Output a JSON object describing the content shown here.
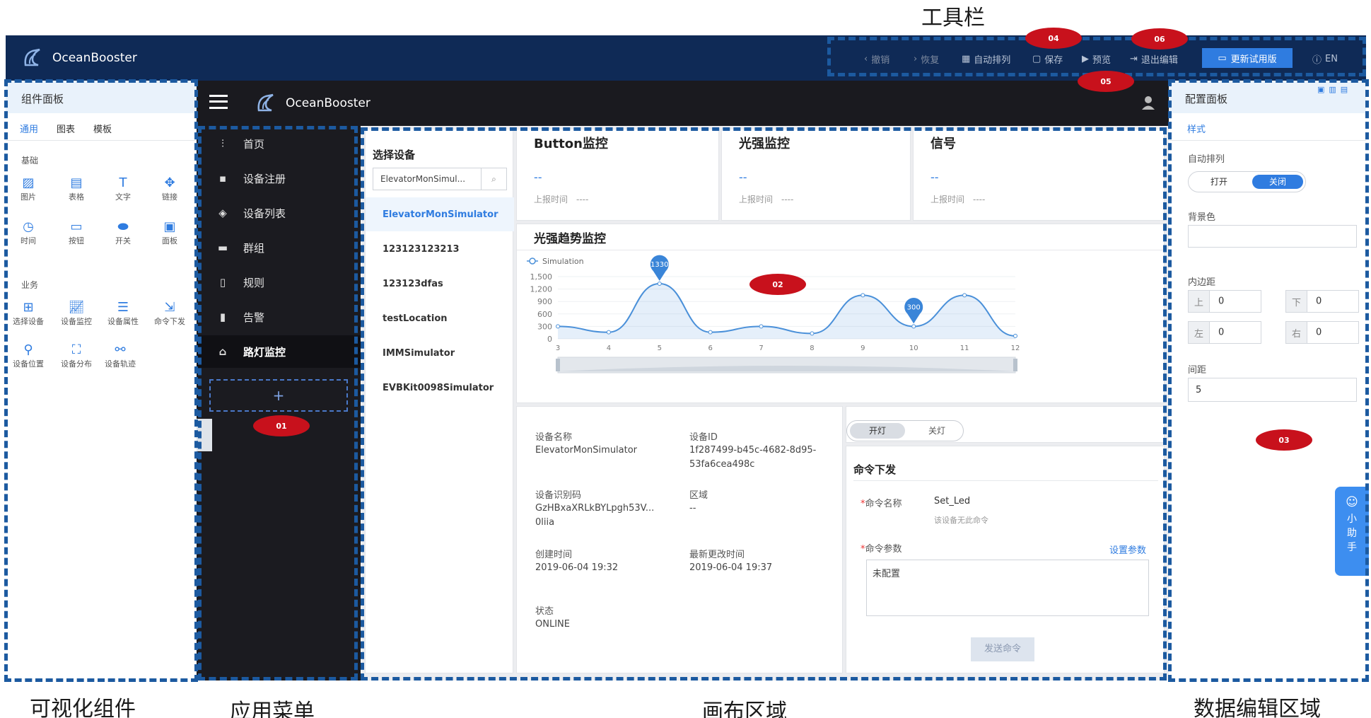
{
  "captions": {
    "toolbar": "工具栏",
    "components": "可视化组件",
    "app_menu": "应用菜单",
    "canvas": "画布区域",
    "data_edit": "数据编辑区域"
  },
  "badges": [
    "01",
    "02",
    "03",
    "04",
    "05",
    "06"
  ],
  "topbar": {
    "brand": "OceanBooster",
    "undo": "撤销",
    "redo": "恢复",
    "auto_arrange": "自动排列",
    "save": "保存",
    "preview": "预览",
    "exit_edit": "退出编辑",
    "trial": "更新试用版",
    "lang": "EN"
  },
  "component_panel": {
    "title": "组件面板",
    "tabs": [
      "通用",
      "图表",
      "模板"
    ],
    "basic_title": "基础",
    "basic": [
      "图片",
      "表格",
      "文字",
      "链接",
      "时间",
      "按钮",
      "开关",
      "面板"
    ],
    "business_title": "业务",
    "business": [
      "选择设备",
      "设备监控",
      "设备属性",
      "命令下发",
      "设备位置",
      "设备分布",
      "设备轨迹"
    ]
  },
  "app": {
    "brand": "OceanBooster",
    "menu": [
      "首页",
      "设备注册",
      "设备列表",
      "群组",
      "规则",
      "告警",
      "路灯监控"
    ],
    "add": "+"
  },
  "canvas": {
    "select_title": "选择设备",
    "search_value": "ElevatorMonSimul...",
    "devices": [
      "ElevatorMonSimulator",
      "123123123213",
      "123123dfas",
      "testLocation",
      "IMMSimulator",
      "EVBKit0098Simulator"
    ],
    "monitors": [
      {
        "title": "Button监控",
        "value": "--",
        "sub": "上报时间　----"
      },
      {
        "title": "光强监控",
        "value": "--",
        "sub": "上报时间　----"
      },
      {
        "title": "信号",
        "value": "--",
        "sub": "上报时间　----"
      }
    ],
    "trend_title": "光强趋势监控",
    "device_info": {
      "name_label": "设备名称",
      "name_value": "ElevatorMonSimulator",
      "id_label": "设备ID",
      "id_value_1": "1f287499-b45c-4682-8d95-",
      "id_value_2": "53fa6cea498c",
      "code_label": "设备识别码",
      "code_value_1": "GzHBxaXRLkBYLpgh53V...",
      "code_value_2": "0liia",
      "area_label": "区域",
      "area_value": "--",
      "created_label": "创建时间",
      "created_value": "2019-06-04 19:32",
      "updated_label": "最新更改时间",
      "updated_value": "2019-06-04 19:37",
      "status_label": "状态",
      "status_value": "ONLINE"
    },
    "light_toggle": {
      "on": "开灯",
      "off": "关灯"
    },
    "command": {
      "title": "命令下发",
      "name_label": "命令名称",
      "name_value": "Set_Led",
      "name_hint": "该设备无此命令",
      "param_label": "命令参数",
      "param_link": "设置参数",
      "param_value": "未配置",
      "send": "发送命令"
    }
  },
  "chart_data": {
    "type": "line",
    "legend": "Simulation",
    "x": [
      3,
      4,
      5,
      6,
      7,
      8,
      9,
      10,
      11,
      12
    ],
    "series": [
      {
        "name": "Simulation",
        "values": [
          300,
          160,
          1330,
          160,
          300,
          130,
          1050,
          300,
          1050,
          70
        ]
      }
    ],
    "ylim": [
      0,
      1500
    ],
    "yticks": [
      0,
      300,
      600,
      900,
      1200,
      1500
    ],
    "ytick_labels": [
      "0",
      "300",
      "600",
      "900",
      "1,200",
      "1,500"
    ],
    "markers": [
      {
        "x": 5,
        "label": "1330"
      },
      {
        "x": 10,
        "label": "300"
      }
    ],
    "color": "#4a90d9"
  },
  "config_panel": {
    "title": "配置面板",
    "tab": "样式",
    "auto_label": "自动排列",
    "auto_on": "打开",
    "auto_off": "关闭",
    "bg_label": "背景色",
    "padding_label": "内边距",
    "top": "上",
    "bottom": "下",
    "left": "左",
    "right": "右",
    "pad_top": "0",
    "pad_bottom": "0",
    "pad_left": "0",
    "pad_right": "0",
    "gap_label": "间距",
    "gap_value": "5",
    "helper": "小助手"
  }
}
